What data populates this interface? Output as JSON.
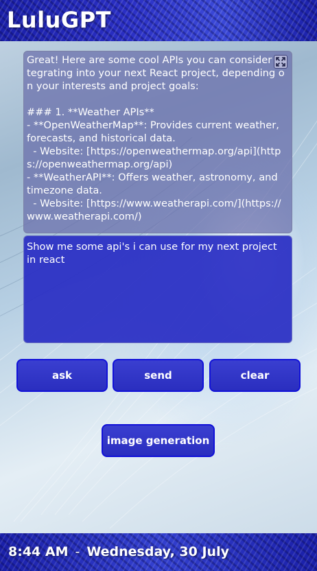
{
  "app": {
    "title": "LuluGPT"
  },
  "response": {
    "text": "Great! Here are some cool APIs you can consider integrating into your next React project, depending on your interests and project goals:\n\n### 1. **Weather APIs**\n- **OpenWeatherMap**: Provides current weather, forecasts, and historical data.\n  - Website: [https://openweathermap.org/api](https://openweathermap.org/api)\n- **WeatherAPI**: Offers weather, astronomy, and timezone data.\n  - Website: [https://www.weatherapi.com/](https://www.weatherapi.com/)"
  },
  "prompt": {
    "value": "Show me some api's i can use for my next project in react"
  },
  "buttons": {
    "ask": "ask",
    "send": "send",
    "clear": "clear",
    "image_generation": "image generation"
  },
  "status": {
    "time": "8:44 AM",
    "separator": "-",
    "date": "Wednesday, 30 July"
  },
  "icons": {
    "expand": "expand-icon"
  },
  "colors": {
    "accent": "#2a2ebf",
    "button_border": "#1010d8",
    "header_bg": "#1a1fa8"
  }
}
